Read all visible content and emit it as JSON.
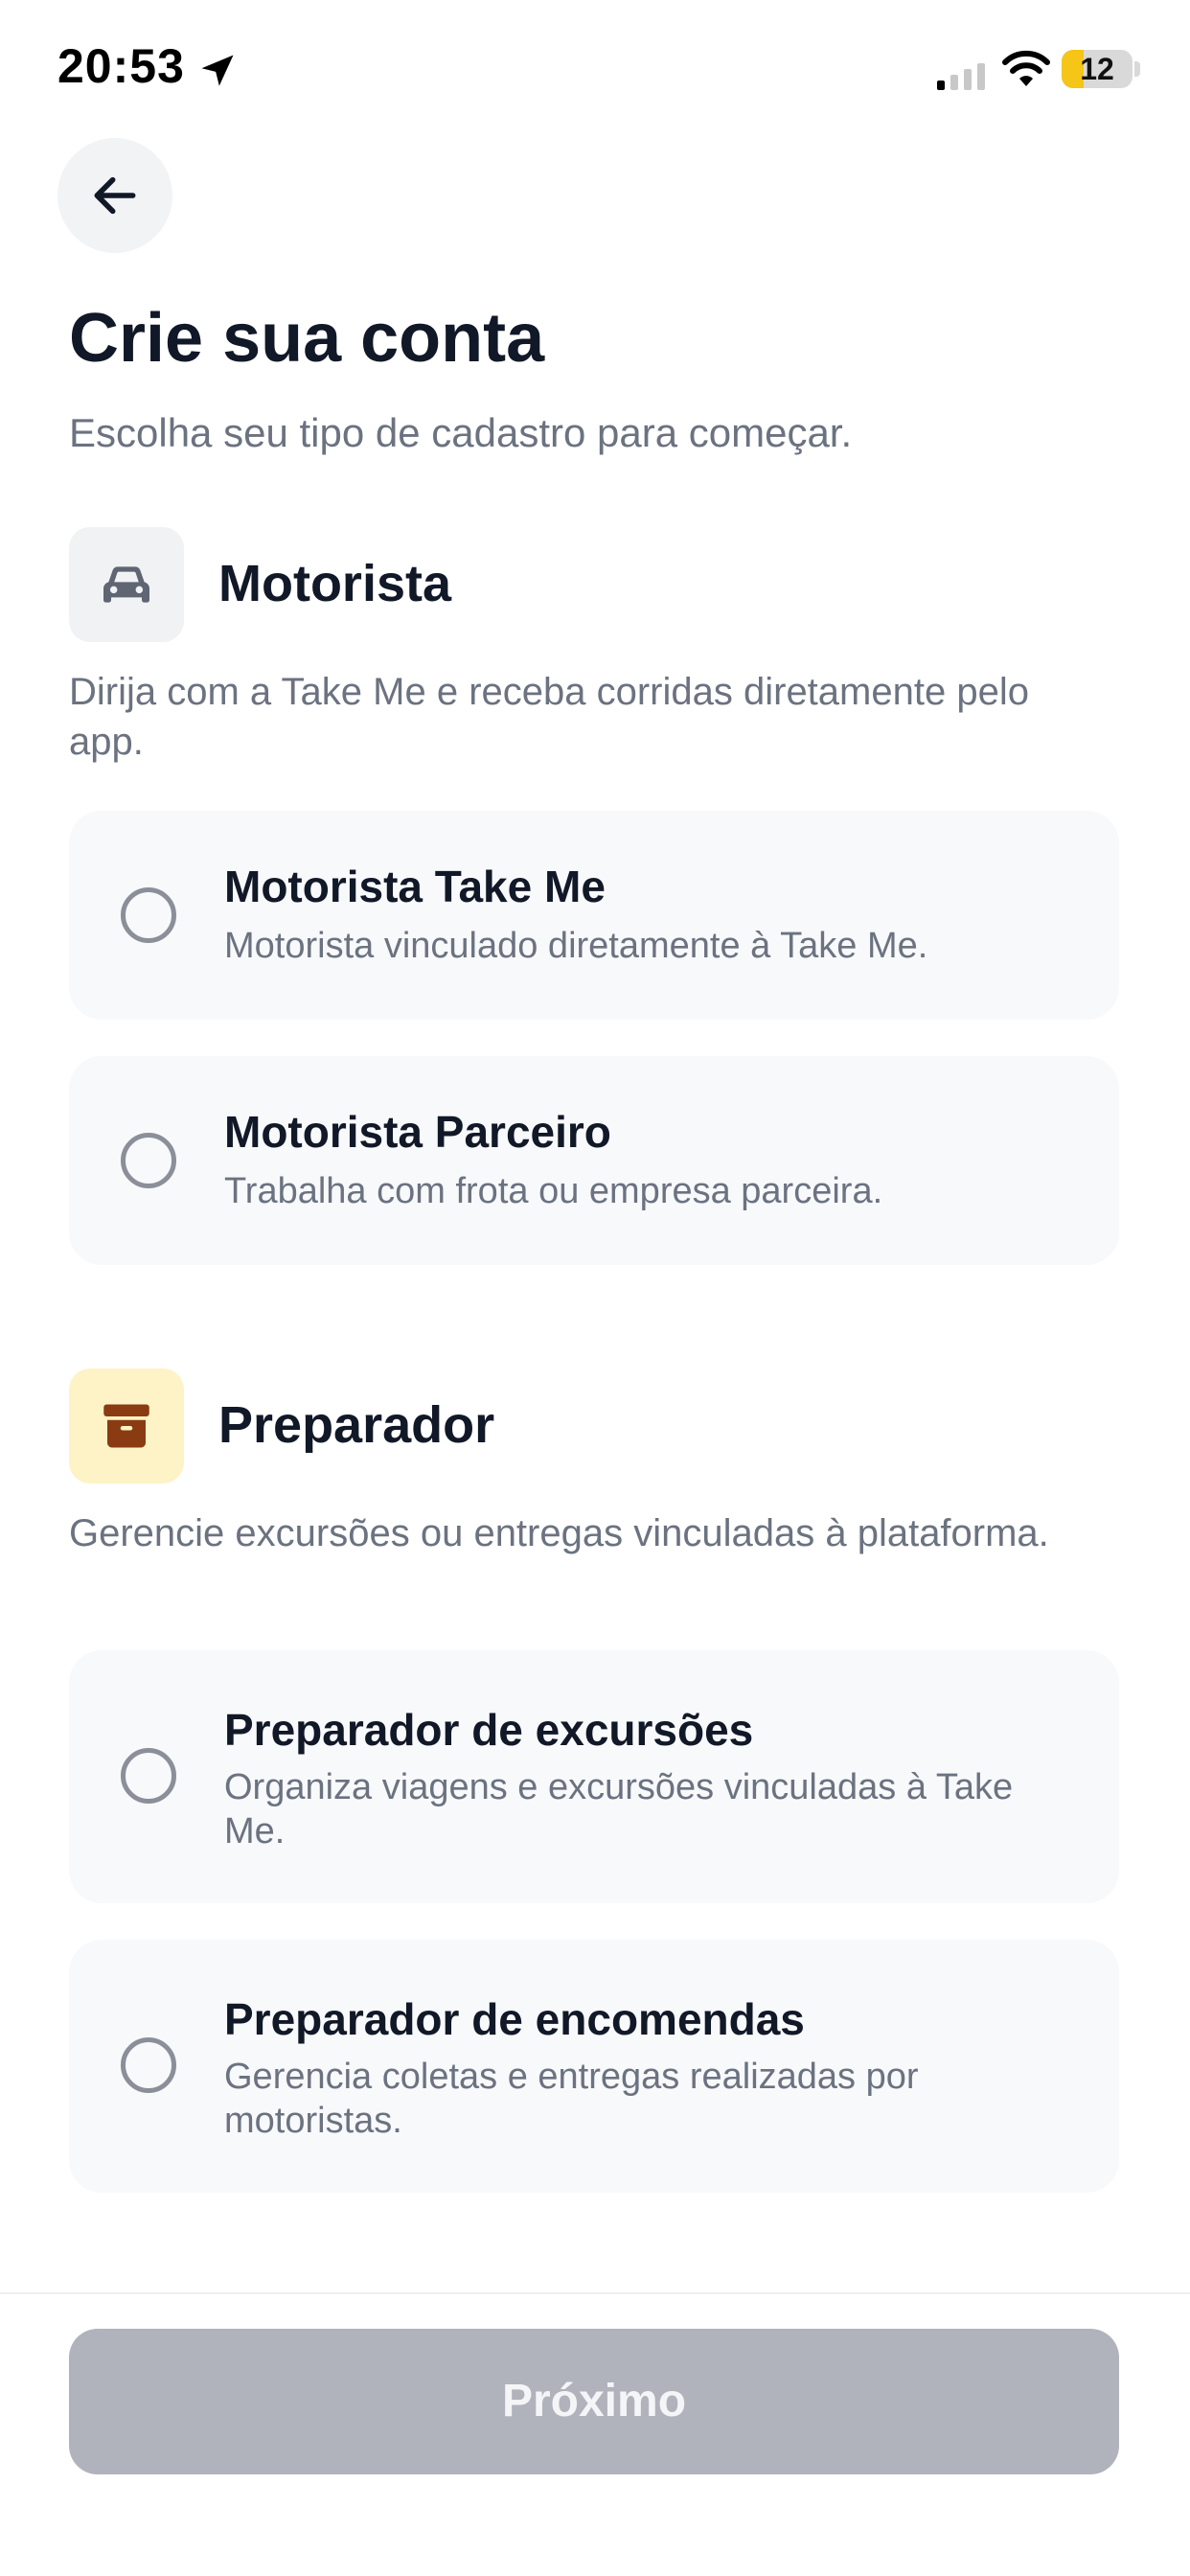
{
  "status_bar": {
    "time": "20:53",
    "battery_level": "12",
    "battery_fraction": 0.12
  },
  "header": {
    "back_icon": "arrow-left-icon",
    "title": "Crie sua conta",
    "subtitle": "Escolha seu tipo de cadastro para começar."
  },
  "sections": [
    {
      "icon": "car-icon",
      "icon_bg": "#f1f2f4",
      "icon_color": "#5f6572",
      "title": "Motorista",
      "description": "Dirija com a Take Me e receba corridas diretamente pelo app.",
      "options": [
        {
          "title": "Motorista Take Me",
          "description": "Motorista vinculado diretamente à Take Me.",
          "selected": false
        },
        {
          "title": "Motorista Parceiro",
          "description": "Trabalha com frota ou empresa parceira.",
          "selected": false
        }
      ]
    },
    {
      "icon": "archive-box-icon",
      "icon_bg": "#fef3c7",
      "icon_color": "#8a3b12",
      "title": "Preparador",
      "description": "Gerencie excursões ou entregas vinculadas à plataforma.",
      "options": [
        {
          "title": "Preparador de excursões",
          "description": "Organiza viagens e excursões vinculadas à Take Me.",
          "selected": false
        },
        {
          "title": "Preparador de encomendas",
          "description": "Gerencia coletas e entregas realizadas por motoristas.",
          "selected": false
        }
      ]
    }
  ],
  "footer": {
    "next_label": "Próximo",
    "next_enabled": false
  },
  "colors": {
    "text_primary": "#111827",
    "text_secondary": "#6b7280",
    "card_bg": "#f8f9fb",
    "button_disabled_bg": "#b0b3bc"
  }
}
